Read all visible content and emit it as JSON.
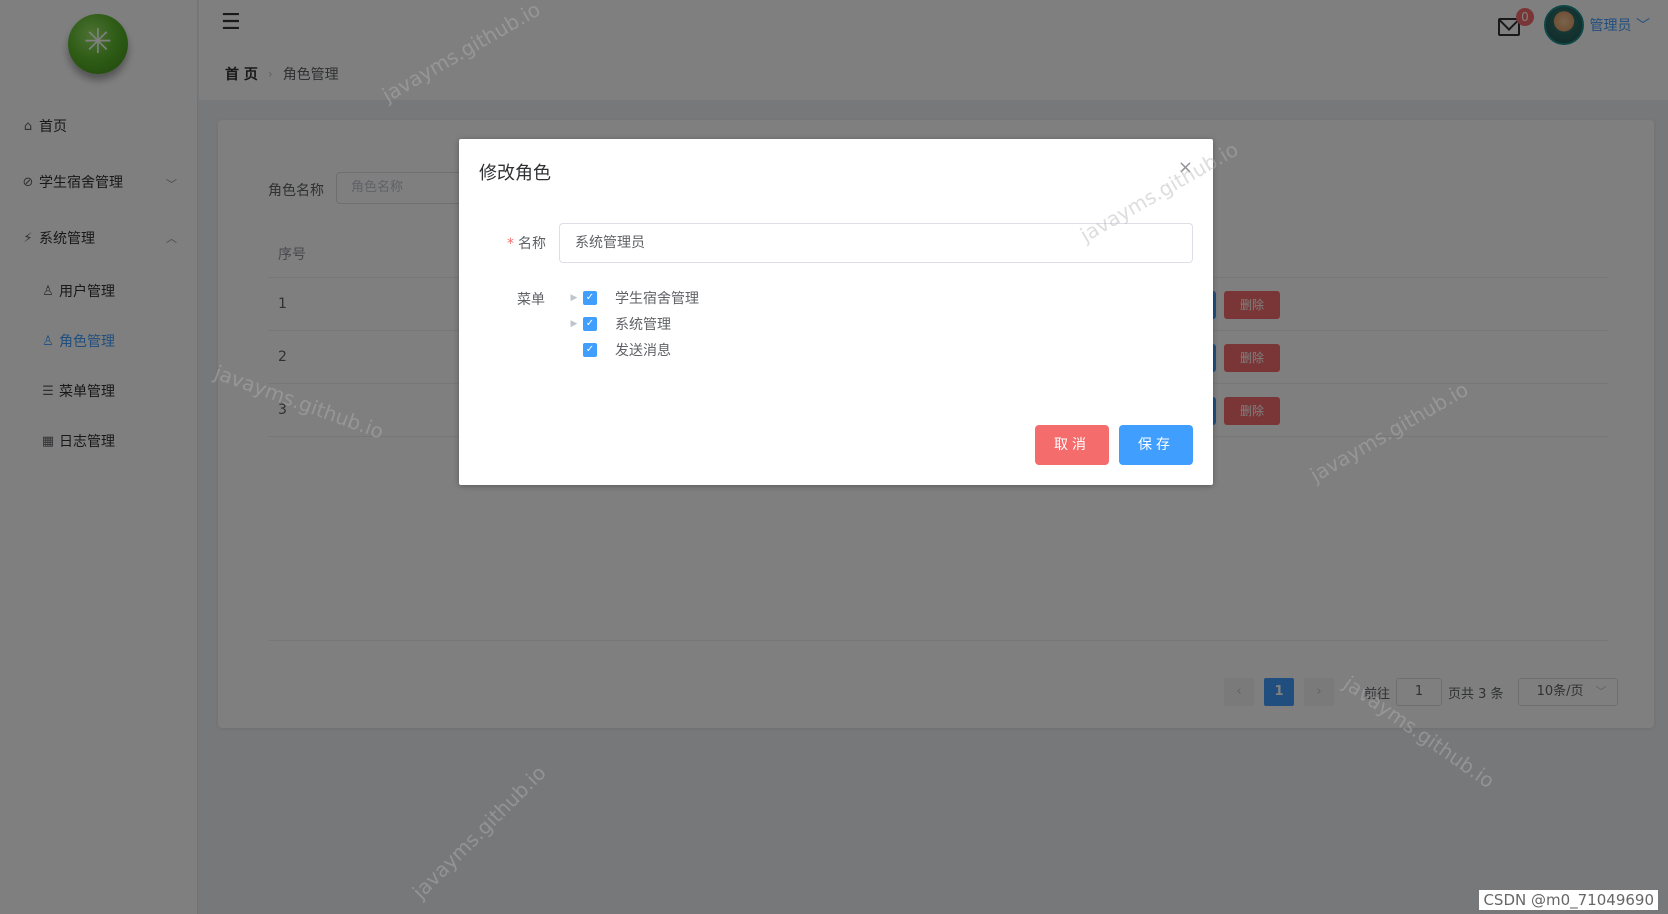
{
  "sidebar": {
    "items": [
      {
        "label": "首页",
        "icon": "home-icon"
      },
      {
        "label": "学生宿舍管理",
        "icon": "paperclip-icon"
      },
      {
        "label": "系统管理",
        "icon": "lightning-icon"
      },
      {
        "label": "用户管理",
        "icon": "user-icon"
      },
      {
        "label": "角色管理",
        "icon": "user-group-icon"
      },
      {
        "label": "菜单管理",
        "icon": "list-icon"
      },
      {
        "label": "日志管理",
        "icon": "calendar-icon"
      }
    ],
    "active": "角色管理"
  },
  "header": {
    "breadcrumb": {
      "home": "首 页",
      "current": "角色管理"
    },
    "mail_badge": "0",
    "user_name": "管理员"
  },
  "page": {
    "search_label": "角色名称",
    "search_placeholder": "角色名称",
    "table": {
      "headers": [
        "序号"
      ],
      "rows": [
        "1",
        "2",
        "3"
      ],
      "delete_label": "删除"
    },
    "pagination": {
      "current_page": "1",
      "goto_label": "前往",
      "goto_value": "1",
      "total_label": "页共 3 条",
      "page_size": "10条/页"
    }
  },
  "dialog": {
    "title": "修改角色",
    "name_label": "名称",
    "name_value": "系统管理员",
    "menu_label": "菜单",
    "tree": [
      {
        "label": "学生宿舍管理",
        "checked": true,
        "expandable": true
      },
      {
        "label": "系统管理",
        "checked": true,
        "expandable": true
      },
      {
        "label": "发送消息",
        "checked": true,
        "expandable": false
      }
    ],
    "cancel_label": "取消",
    "save_label": "保存"
  },
  "watermark": "javayms.github.io",
  "footer_credit": "CSDN @m0_71049690",
  "colors": {
    "primary": "#409eff",
    "danger": "#f56c6c",
    "overlay": "rgba(0,0,0,0.5)"
  }
}
